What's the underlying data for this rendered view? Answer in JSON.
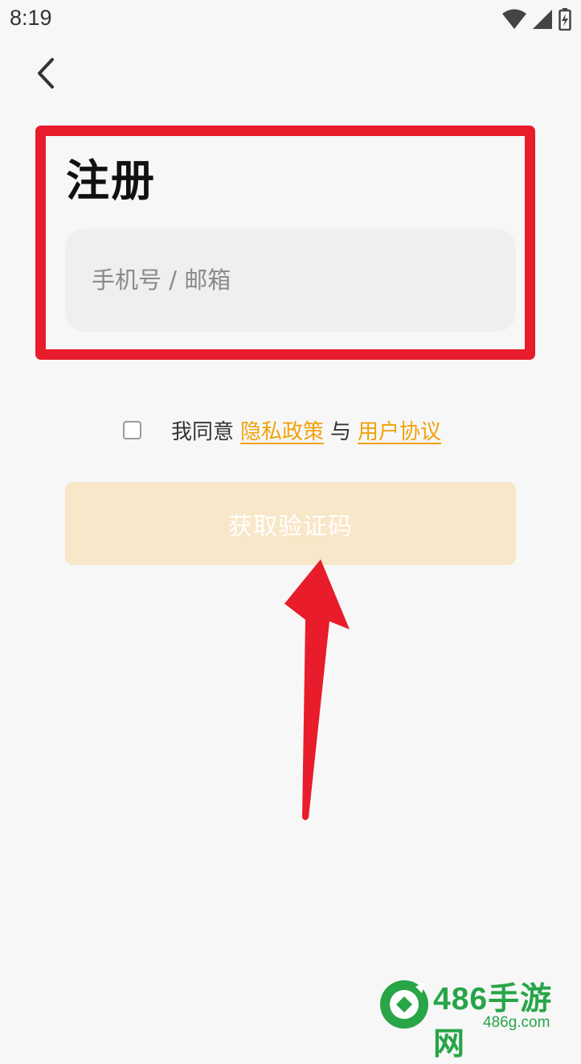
{
  "status_bar": {
    "time": "8:19",
    "icons": [
      "wifi-icon",
      "signal-icon",
      "battery-icon"
    ]
  },
  "header": {
    "back_icon": "chevron-left-icon",
    "title": "注册"
  },
  "form": {
    "account_placeholder": "手机号 / 邮箱",
    "account_value": ""
  },
  "agreement": {
    "checked": false,
    "prefix": "我同意",
    "privacy_link": "隐私政策",
    "joiner": "与",
    "terms_link": "用户协议"
  },
  "actions": {
    "get_code_label": "获取验证码"
  },
  "annotation": {
    "highlight_color": "#e81c2b",
    "arrow_color": "#e81c2b"
  },
  "watermark": {
    "name": "486手游网",
    "domain": "486g.com"
  },
  "colors": {
    "accent": "#f0a20a",
    "button_disabled_bg": "#f8e7c8",
    "input_bg": "#efefef",
    "page_bg": "#f7f7f7"
  }
}
